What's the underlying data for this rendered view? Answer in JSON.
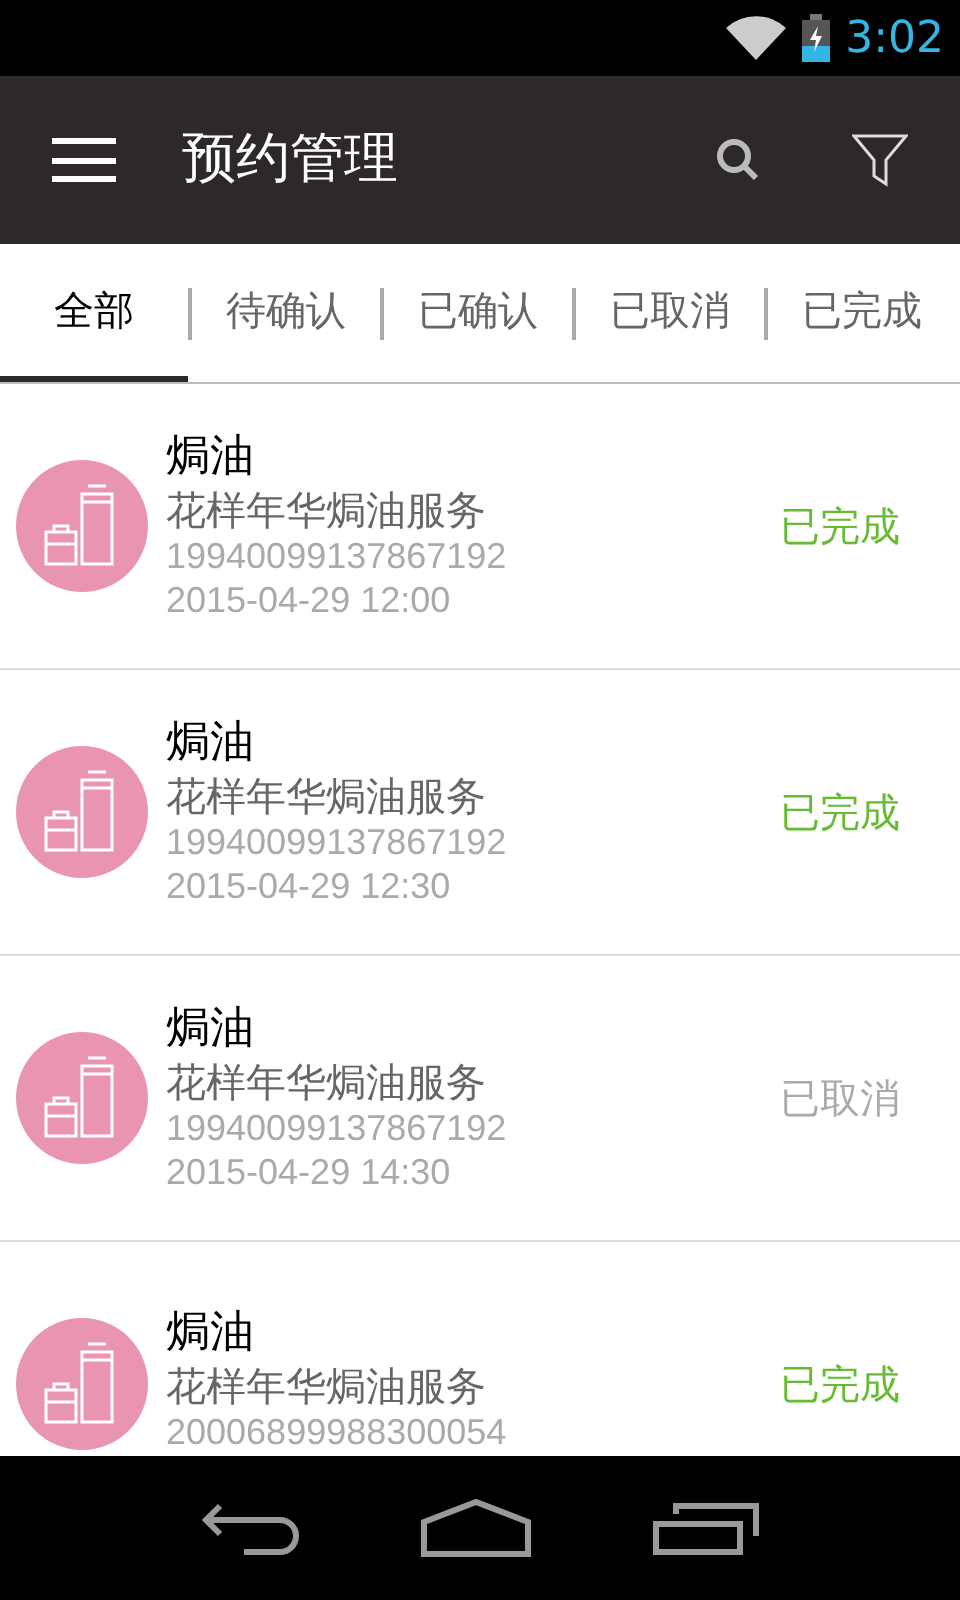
{
  "status_bar": {
    "time": "3:02"
  },
  "app_bar": {
    "title": "预约管理"
  },
  "tabs": [
    {
      "label": "全部",
      "selected": true
    },
    {
      "label": "待确认",
      "selected": false
    },
    {
      "label": "已确认",
      "selected": false
    },
    {
      "label": "已取消",
      "selected": false
    },
    {
      "label": "已完成",
      "selected": false
    }
  ],
  "orders": [
    {
      "title": "焗油",
      "service": "花样年华焗油服务",
      "number": "19940099137867192",
      "time": "2015-04-29 12:00",
      "status": "已完成",
      "kind": "done"
    },
    {
      "title": "焗油",
      "service": "花样年华焗油服务",
      "number": "19940099137867192",
      "time": "2015-04-29 12:30",
      "status": "已完成",
      "kind": "done"
    },
    {
      "title": "焗油",
      "service": "花样年华焗油服务",
      "number": "19940099137867192",
      "time": "2015-04-29 14:30",
      "status": "已取消",
      "kind": "cancelled"
    },
    {
      "title": "焗油",
      "service": "花样年华焗油服务",
      "number": "20006899988300054",
      "status": "已完成",
      "kind": "done"
    }
  ]
}
